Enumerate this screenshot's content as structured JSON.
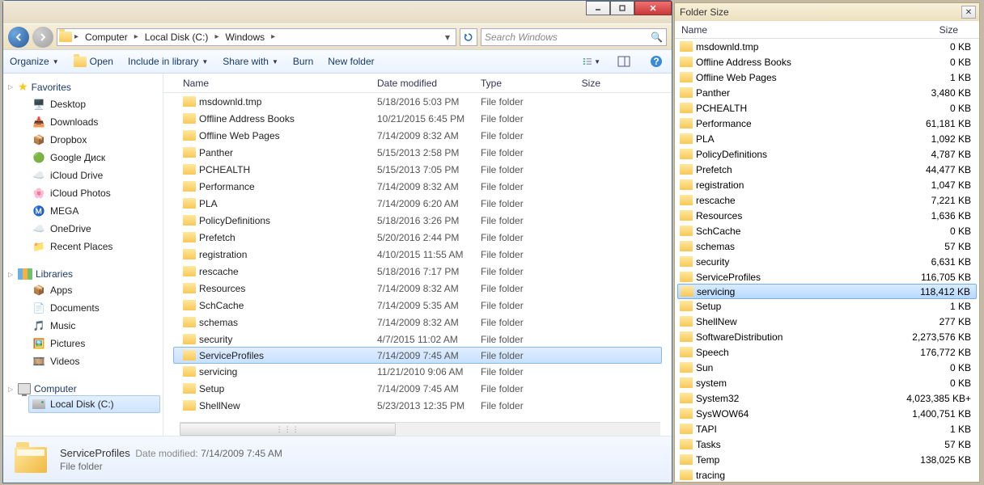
{
  "explorer": {
    "breadcrumb": [
      "Computer",
      "Local Disk (C:)",
      "Windows"
    ],
    "search_placeholder": "Search Windows",
    "toolbar": {
      "organize": "Organize",
      "open": "Open",
      "include": "Include in library",
      "share": "Share with",
      "burn": "Burn",
      "newfolder": "New folder"
    },
    "nav": {
      "favorites": {
        "label": "Favorites",
        "items": [
          "Desktop",
          "Downloads",
          "Dropbox",
          "Google Диск",
          "iCloud Drive",
          "iCloud Photos",
          "MEGA",
          "OneDrive",
          "Recent Places"
        ]
      },
      "libraries": {
        "label": "Libraries",
        "items": [
          "Apps",
          "Documents",
          "Music",
          "Pictures",
          "Videos"
        ]
      },
      "computer": {
        "label": "Computer",
        "items": [
          "Local Disk (C:)"
        ]
      }
    },
    "columns": {
      "name": "Name",
      "date": "Date modified",
      "type": "Type",
      "size": "Size"
    },
    "files": [
      {
        "name": "msdownld.tmp",
        "date": "5/18/2016 5:03 PM",
        "type": "File folder"
      },
      {
        "name": "Offline Address Books",
        "date": "10/21/2015 6:45 PM",
        "type": "File folder"
      },
      {
        "name": "Offline Web Pages",
        "date": "7/14/2009 8:32 AM",
        "type": "File folder"
      },
      {
        "name": "Panther",
        "date": "5/15/2013 2:58 PM",
        "type": "File folder"
      },
      {
        "name": "PCHEALTH",
        "date": "5/15/2013 7:05 PM",
        "type": "File folder"
      },
      {
        "name": "Performance",
        "date": "7/14/2009 8:32 AM",
        "type": "File folder"
      },
      {
        "name": "PLA",
        "date": "7/14/2009 6:20 AM",
        "type": "File folder"
      },
      {
        "name": "PolicyDefinitions",
        "date": "5/18/2016 3:26 PM",
        "type": "File folder"
      },
      {
        "name": "Prefetch",
        "date": "5/20/2016 2:44 PM",
        "type": "File folder"
      },
      {
        "name": "registration",
        "date": "4/10/2015 11:55 AM",
        "type": "File folder"
      },
      {
        "name": "rescache",
        "date": "5/18/2016 7:17 PM",
        "type": "File folder"
      },
      {
        "name": "Resources",
        "date": "7/14/2009 8:32 AM",
        "type": "File folder"
      },
      {
        "name": "SchCache",
        "date": "7/14/2009 5:35 AM",
        "type": "File folder"
      },
      {
        "name": "schemas",
        "date": "7/14/2009 8:32 AM",
        "type": "File folder"
      },
      {
        "name": "security",
        "date": "4/7/2015 11:02 AM",
        "type": "File folder"
      },
      {
        "name": "ServiceProfiles",
        "date": "7/14/2009 7:45 AM",
        "type": "File folder",
        "selected": true
      },
      {
        "name": "servicing",
        "date": "11/21/2010 9:06 AM",
        "type": "File folder"
      },
      {
        "name": "Setup",
        "date": "7/14/2009 7:45 AM",
        "type": "File folder"
      },
      {
        "name": "ShellNew",
        "date": "5/23/2013 12:35 PM",
        "type": "File folder"
      }
    ],
    "details": {
      "name": "ServiceProfiles",
      "date_label": "Date modified:",
      "date": "7/14/2009 7:45 AM",
      "type": "File folder"
    }
  },
  "foldersize": {
    "title": "Folder Size",
    "columns": {
      "name": "Name",
      "size": "Size"
    },
    "rows": [
      {
        "name": "msdownld.tmp",
        "size": "0 KB"
      },
      {
        "name": "Offline Address Books",
        "size": "0 KB"
      },
      {
        "name": "Offline Web Pages",
        "size": "1 KB"
      },
      {
        "name": "Panther",
        "size": "3,480 KB"
      },
      {
        "name": "PCHEALTH",
        "size": "0 KB"
      },
      {
        "name": "Performance",
        "size": "61,181 KB"
      },
      {
        "name": "PLA",
        "size": "1,092 KB"
      },
      {
        "name": "PolicyDefinitions",
        "size": "4,787 KB"
      },
      {
        "name": "Prefetch",
        "size": "44,477 KB"
      },
      {
        "name": "registration",
        "size": "1,047 KB"
      },
      {
        "name": "rescache",
        "size": "7,221 KB"
      },
      {
        "name": "Resources",
        "size": "1,636 KB"
      },
      {
        "name": "SchCache",
        "size": "0 KB"
      },
      {
        "name": "schemas",
        "size": "57 KB"
      },
      {
        "name": "security",
        "size": "6,631 KB"
      },
      {
        "name": "ServiceProfiles",
        "size": "116,705 KB"
      },
      {
        "name": "servicing",
        "size": "118,412 KB",
        "selected": true
      },
      {
        "name": "Setup",
        "size": "1 KB"
      },
      {
        "name": "ShellNew",
        "size": "277 KB"
      },
      {
        "name": "SoftwareDistribution",
        "size": "2,273,576 KB"
      },
      {
        "name": "Speech",
        "size": "176,772 KB"
      },
      {
        "name": "Sun",
        "size": "0 KB"
      },
      {
        "name": "system",
        "size": "0 KB"
      },
      {
        "name": "System32",
        "size": "4,023,385 KB+"
      },
      {
        "name": "SysWOW64",
        "size": "1,400,751 KB"
      },
      {
        "name": "TAPI",
        "size": "1 KB"
      },
      {
        "name": "Tasks",
        "size": "57 KB"
      },
      {
        "name": "Temp",
        "size": "138,025 KB"
      },
      {
        "name": "tracing",
        "size": ""
      }
    ]
  }
}
